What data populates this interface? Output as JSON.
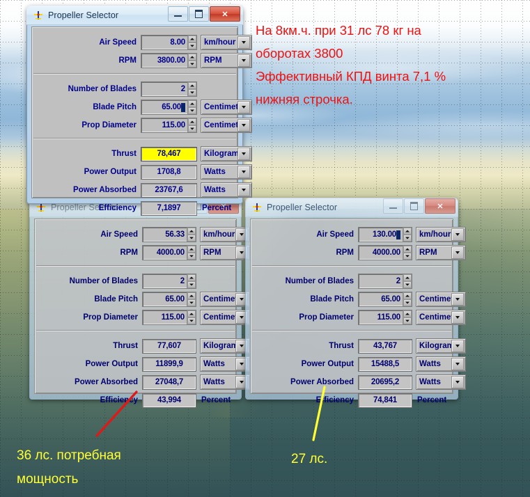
{
  "desktop": {
    "background_description": "landscape-photo-with-dotted-design-grid",
    "colors": {
      "sky": "#9cc0dd",
      "field": "#d7d6ae",
      "water": "#3f6160",
      "annotation_red": "#ee1111",
      "annotation_yellow": "#ffff33",
      "highlight_yellow": "#ffff00",
      "label_blue": "#00008b",
      "title_active": "#17324f"
    }
  },
  "annotations": {
    "red_note": "На 8км.ч. при 31 лс 78 кг на\nоборотах 3800\nЭффективный КПД винта 7,1 %\nнижняя строчка.",
    "yellow_note_left": "36 лс. потребная\nмощность",
    "yellow_note_right": "27 лс.",
    "red_arrow_name": "red-pointer-arrow",
    "yellow_arrow_name": "yellow-pointer-arrow"
  },
  "common": {
    "title": "Propeller Selector",
    "app_icon": "propeller-airplane-icon",
    "minimize_label": "Minimize",
    "maximize_label": "Maximize",
    "close_label": "Close",
    "labels": {
      "air_speed": "Air Speed",
      "rpm": "RPM",
      "number_of_blades": "Number of Blades",
      "blade_pitch": "Blade Pitch",
      "prop_diameter": "Prop Diameter",
      "thrust": "Thrust",
      "power_output": "Power Output",
      "power_absorbed": "Power Absorbed",
      "efficiency": "Efficiency"
    },
    "units": {
      "kmh": "km/hour",
      "rpm": "RPM",
      "centimeter": "Centimete",
      "kilograms": "Kilograms",
      "watts": "Watts",
      "percent": "Percent"
    }
  },
  "windows": [
    {
      "id": "window-1",
      "state": "active",
      "title": "Propeller Selector",
      "inputs": {
        "air_speed": "8.00",
        "rpm": "3800.00",
        "number_of_blades": "2",
        "blade_pitch": "65.00",
        "prop_diameter": "115.00"
      },
      "input_units": {
        "air_speed": "km/hour",
        "rpm": "RPM",
        "blade_pitch": "Centimete",
        "prop_diameter": "Centimete"
      },
      "outputs": {
        "thrust": "78,467",
        "power_output": "1708,8",
        "power_absorbed": "23767,6",
        "efficiency": "7,1897"
      },
      "output_units": {
        "thrust": "Kilograms",
        "power_output": "Watts",
        "power_absorbed": "Watts",
        "efficiency": "Percent"
      },
      "thrust_highlighted": true
    },
    {
      "id": "window-2",
      "state": "inactive",
      "title": "Propeller Selector",
      "inputs": {
        "air_speed": "56.33",
        "rpm": "4000.00",
        "number_of_blades": "2",
        "blade_pitch": "65.00",
        "prop_diameter": "115.00"
      },
      "input_units": {
        "air_speed": "km/hour",
        "rpm": "RPM",
        "blade_pitch": "Centimete",
        "prop_diameter": "Centimete"
      },
      "outputs": {
        "thrust": "77,607",
        "power_output": "11899,9",
        "power_absorbed": "27048,7",
        "efficiency": "43,994"
      },
      "output_units": {
        "thrust": "Kilograms",
        "power_output": "Watts",
        "power_absorbed": "Watts",
        "efficiency": "Percent"
      },
      "thrust_highlighted": false
    },
    {
      "id": "window-3",
      "state": "inactive",
      "title": "Propeller Selector",
      "inputs": {
        "air_speed": "130.00",
        "rpm": "4000.00",
        "number_of_blades": "2",
        "blade_pitch": "65.00",
        "prop_diameter": "115.00"
      },
      "input_units": {
        "air_speed": "km/hour",
        "rpm": "RPM",
        "blade_pitch": "Centimete",
        "prop_diameter": "Centimete"
      },
      "outputs": {
        "thrust": "43,767",
        "power_output": "15488,5",
        "power_absorbed": "20695,2",
        "efficiency": "74,841"
      },
      "output_units": {
        "thrust": "Kilograms",
        "power_output": "Watts",
        "power_absorbed": "Watts",
        "efficiency": "Percent"
      },
      "thrust_highlighted": false
    }
  ]
}
